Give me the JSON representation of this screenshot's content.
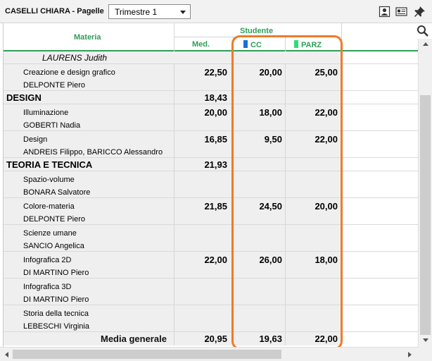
{
  "header": {
    "title": "CASELLI CHIARA - Pagelle",
    "period_selected": "Trimestre 1",
    "icons": [
      "id-card-icon",
      "report-card-icon",
      "pin-icon"
    ]
  },
  "table": {
    "columns": {
      "materia": "Materia",
      "studente": "Studente",
      "med": "Med.",
      "cc": "CC",
      "parz": "PARZ"
    },
    "column_colors": {
      "cc": "#1a6fd6",
      "parz": "#2fdc7a"
    },
    "rows": [
      {
        "kind": "italic",
        "name": "LAURENS Judith",
        "med": "",
        "cc": "",
        "parz": ""
      },
      {
        "kind": "sub",
        "name": "Creazione e design grafico",
        "teacher": "DELPONTE Piero",
        "med": "22,50",
        "cc": "20,00",
        "parz": "25,00"
      },
      {
        "kind": "cat",
        "name": "DESIGN",
        "med": "18,43",
        "cc": "",
        "parz": ""
      },
      {
        "kind": "sub",
        "name": "Illuminazione",
        "teacher": "GOBERTI Nadia",
        "med": "20,00",
        "cc": "18,00",
        "parz": "22,00"
      },
      {
        "kind": "sub",
        "name": "Design",
        "teacher": "ANDREIS Filippo, BARICCO Alessandro",
        "med": "16,85",
        "cc": "9,50",
        "parz": "22,00"
      },
      {
        "kind": "cat",
        "name": "TEORIA E TECNICA",
        "med": "21,93",
        "cc": "",
        "parz": ""
      },
      {
        "kind": "sub",
        "name": "Spazio-volume",
        "teacher": "BONARA Salvatore",
        "med": "",
        "cc": "",
        "parz": ""
      },
      {
        "kind": "sub",
        "name": "Colore-materia",
        "teacher": "DELPONTE Piero",
        "med": "21,85",
        "cc": "24,50",
        "parz": "20,00"
      },
      {
        "kind": "sub",
        "name": "Scienze umane",
        "teacher": "SANCIO Angelica",
        "med": "",
        "cc": "",
        "parz": ""
      },
      {
        "kind": "sub",
        "name": "Infografica 2D",
        "teacher": "DI MARTINO Piero",
        "med": "22,00",
        "cc": "26,00",
        "parz": "18,00"
      },
      {
        "kind": "sub",
        "name": "Infografica 3D",
        "teacher": "DI MARTINO Piero",
        "med": "",
        "cc": "",
        "parz": ""
      },
      {
        "kind": "sub",
        "name": "Storia della tecnica",
        "teacher": "LEBESCHI Virginia",
        "med": "",
        "cc": "",
        "parz": ""
      }
    ],
    "footer": {
      "label": "Media generale",
      "med": "20,95",
      "cc": "19,63",
      "parz": "22,00"
    }
  },
  "highlight_color": "#ee7b2a"
}
